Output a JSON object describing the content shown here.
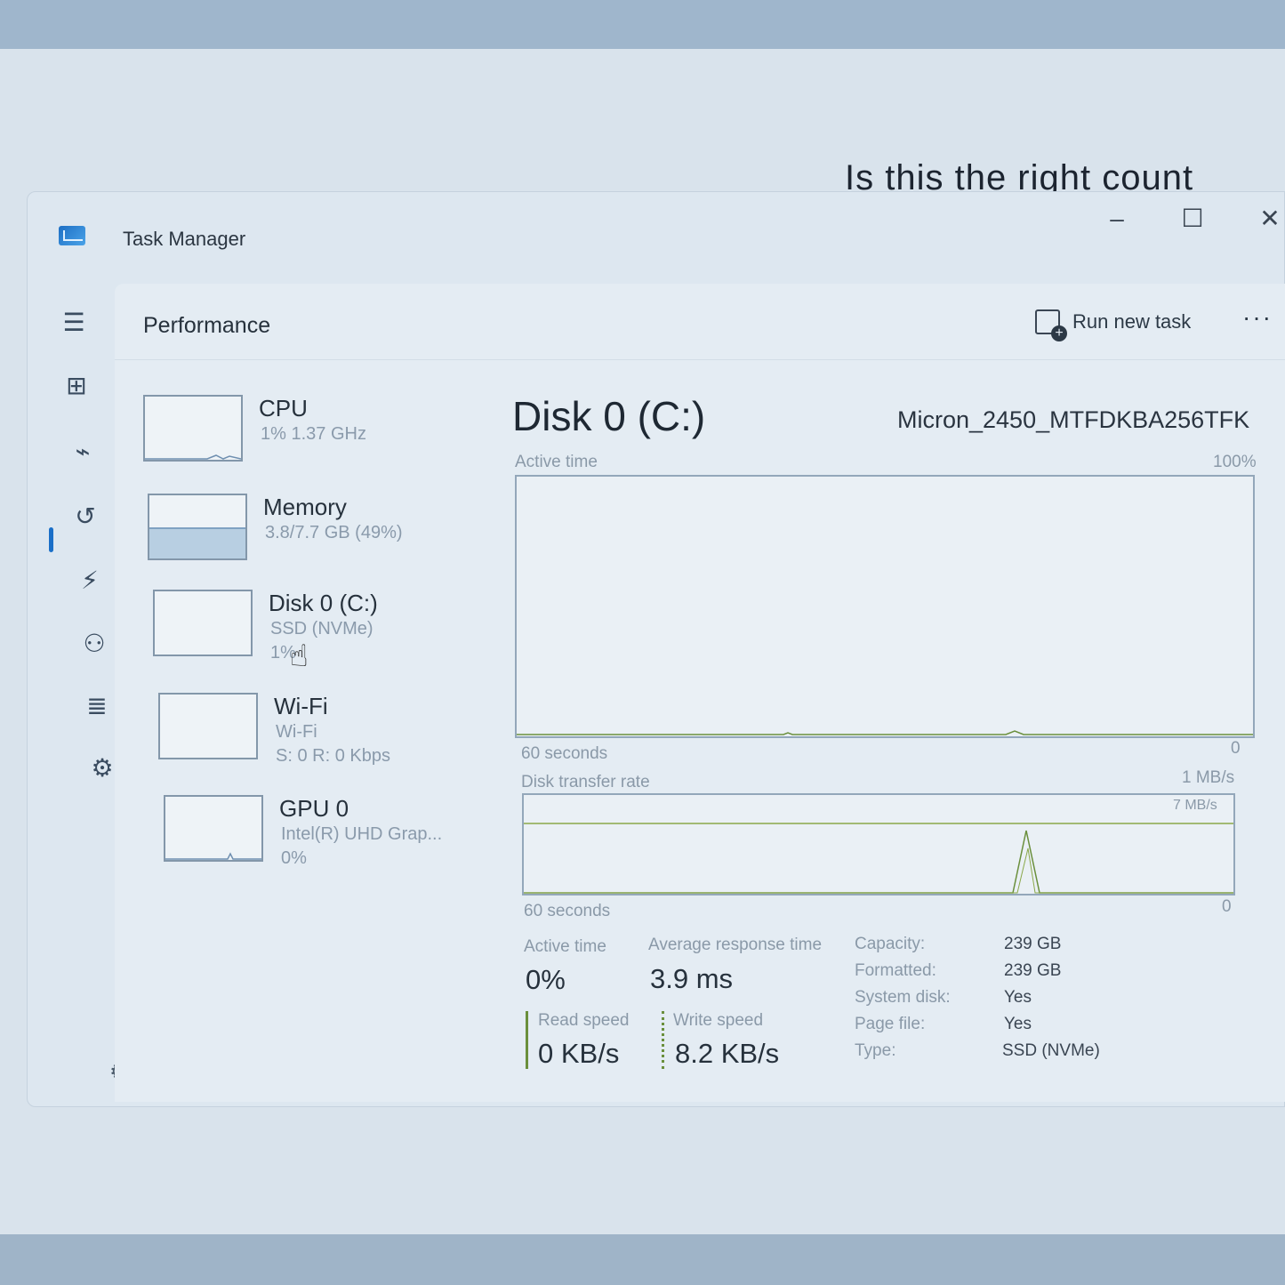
{
  "background_text": "Is this the right count",
  "window": {
    "title": "Task Manager",
    "minimize": "–",
    "maximize": "☐",
    "close": "✕"
  },
  "header": {
    "page_title": "Performance",
    "run_new_task": "Run new task",
    "more": "···"
  },
  "sidebar": {
    "items": [
      {
        "name": "hamburger-icon",
        "glyph": "☰"
      },
      {
        "name": "processes-icon",
        "glyph": "⊞"
      },
      {
        "name": "performance-icon",
        "glyph": "⌁"
      },
      {
        "name": "app-history-icon",
        "glyph": "↺"
      },
      {
        "name": "startup-apps-icon",
        "glyph": "⚡"
      },
      {
        "name": "users-icon",
        "glyph": "⚇"
      },
      {
        "name": "details-icon",
        "glyph": "≣"
      },
      {
        "name": "services-icon",
        "glyph": "⚙"
      }
    ],
    "settings_glyph": "⚙"
  },
  "devices": [
    {
      "name": "CPU",
      "sub1": "1% 1.37 GHz",
      "sub2": ""
    },
    {
      "name": "Memory",
      "sub1": "3.8/7.7 GB (49%)",
      "sub2": "",
      "fill_fraction": 0.49
    },
    {
      "name": "Disk 0 (C:)",
      "sub1": "SSD (NVMe)",
      "sub2": "1%"
    },
    {
      "name": "Wi-Fi",
      "sub1": "Wi-Fi",
      "sub2": "S: 0 R: 0 Kbps"
    },
    {
      "name": "GPU 0",
      "sub1": "Intel(R) UHD Grap...",
      "sub2": "0%"
    }
  ],
  "detail": {
    "title": "Disk 0 (C:)",
    "model": "Micron_2450_MTFDKBA256TFK",
    "active_time_label": "Active time",
    "active_time_max": "100%",
    "seconds_label": "60 seconds",
    "zero": "0",
    "transfer_label": "Disk transfer rate",
    "transfer_max": "1 MB/s",
    "transfer_inner": "7 MB/s"
  },
  "stats": {
    "active_time_label": "Active time",
    "active_time_value": "0%",
    "avg_response_label": "Average response time",
    "avg_response_value": "3.9 ms",
    "read_label": "Read speed",
    "read_value": "0 KB/s",
    "write_label": "Write speed",
    "write_value": "8.2 KB/s"
  },
  "properties": [
    {
      "label": "Capacity:",
      "value": "239 GB"
    },
    {
      "label": "Formatted:",
      "value": "239 GB"
    },
    {
      "label": "System disk:",
      "value": "Yes"
    },
    {
      "label": "Page file:",
      "value": "Yes"
    },
    {
      "label": "Type:",
      "value": "SSD (NVMe)"
    }
  ],
  "colors": {
    "accent": "#1a6fc8",
    "graph_line": "#6a8f3c"
  }
}
